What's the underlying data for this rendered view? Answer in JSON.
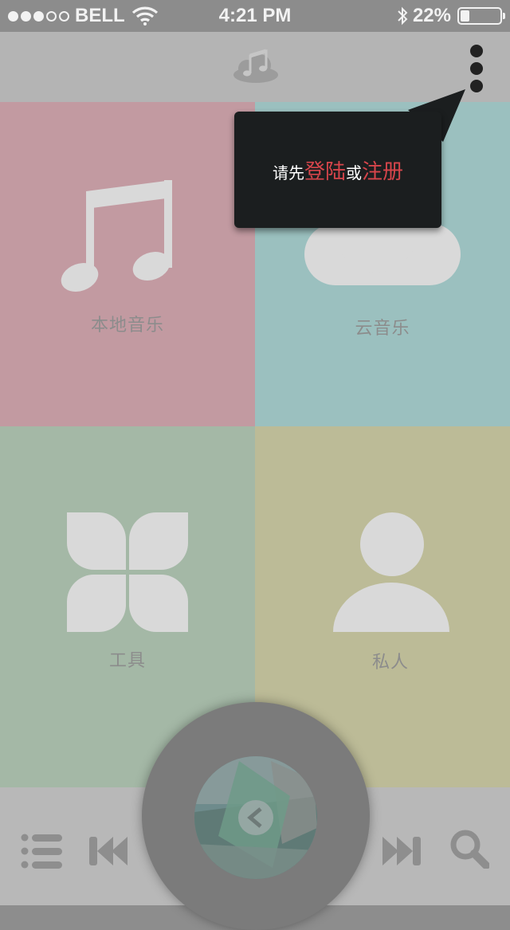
{
  "status_bar": {
    "carrier": "BELL",
    "time": "4:21 PM",
    "battery_text": "22%",
    "battery_level": 0.22,
    "signal_bars_filled": 3,
    "signal_bars_total": 5
  },
  "header": {
    "logo_icon": "cloud-music-logo-icon",
    "menu_icon": "vertical-dots-icon"
  },
  "popup": {
    "prefix": "请先",
    "login": "登陆",
    "or": "或",
    "register": "注册"
  },
  "tiles": [
    {
      "label": "本地音乐",
      "icon": "music-note-icon",
      "color": "#e9bbc3"
    },
    {
      "label": "云音乐",
      "icon": "cloud-icon",
      "color": "#bde8e6"
    },
    {
      "label": "工具",
      "icon": "tools-petals-icon",
      "color": "#cbeccd"
    },
    {
      "label": "私人",
      "icon": "user-icon",
      "color": "#ece8b9"
    }
  ],
  "player": {
    "controls": [
      "playlist-icon",
      "previous-icon",
      "play-icon",
      "next-icon",
      "search-icon"
    ]
  },
  "colors": {
    "popup_bg": "#1b1e1f",
    "highlight": "#d6454b"
  }
}
